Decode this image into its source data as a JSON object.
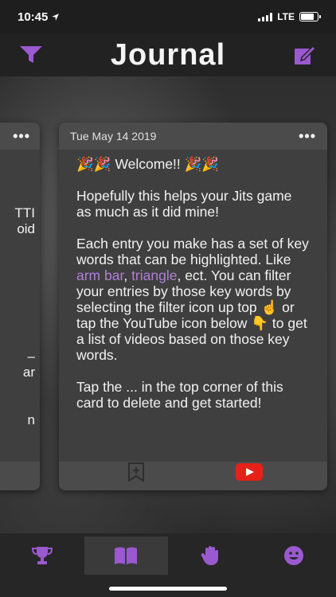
{
  "status_bar": {
    "time": "10:45",
    "network": "LTE"
  },
  "header": {
    "title": "Journal"
  },
  "left_card": {
    "lines": [
      "TTI",
      "oid",
      "–",
      "ar",
      "n"
    ]
  },
  "card": {
    "date": "Tue May 14 2019",
    "menu_label": "•••",
    "welcome": "🎉🎉 Welcome!! 🎉🎉",
    "para1": "Hopefully this helps your Jits game as much as it did mine!",
    "para2_before": "Each entry you make has a set of key words that can be highlighted. Like ",
    "keyword1": "arm bar",
    "para2_comma": ", ",
    "keyword2": "triangle",
    "para2_after": ", ect. You can filter your entries by those key words by selecting the filter icon up top ☝️  or tap the YouTube icon below 👇 to get a list of videos based on those key words.",
    "para3": "Tap the ... in the top corner of this card to delete and get started!"
  },
  "tabs": [
    {
      "name": "trophy-icon",
      "active": false
    },
    {
      "name": "book-icon",
      "active": true
    },
    {
      "name": "hand-icon",
      "active": false
    },
    {
      "name": "smiley-icon",
      "active": false
    }
  ],
  "colors": {
    "accent": "#9b59d0",
    "keyword": "#b07fd6",
    "youtube": "#e62117"
  }
}
